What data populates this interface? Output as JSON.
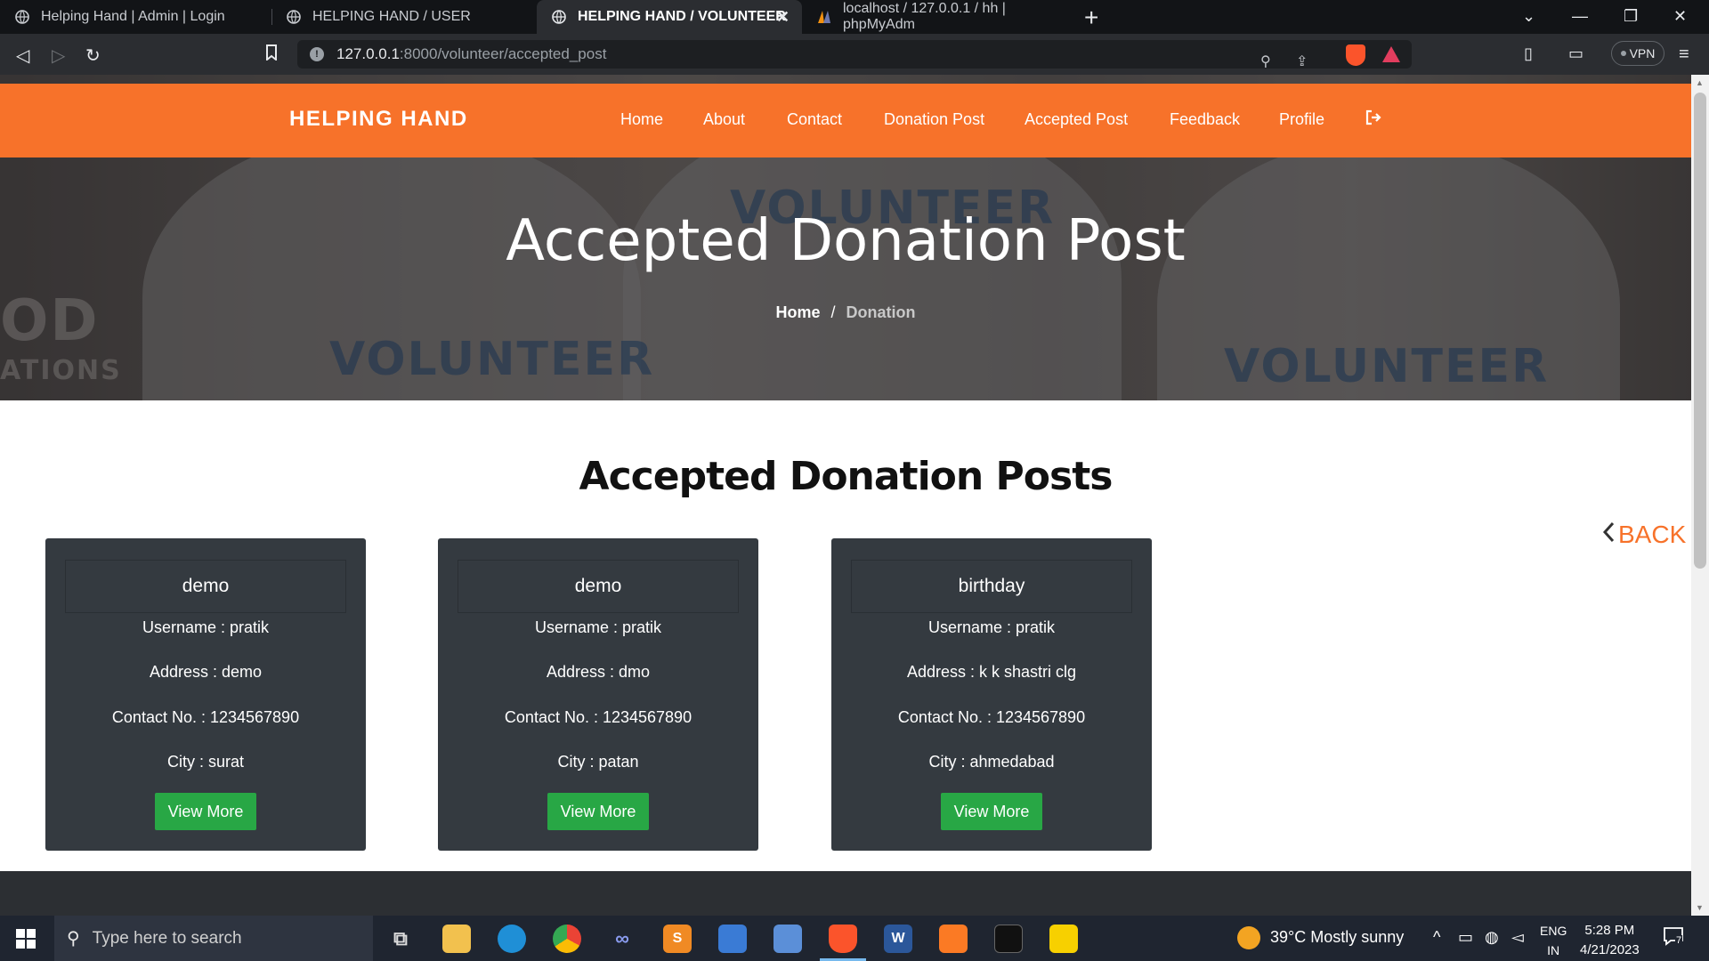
{
  "browser": {
    "tabs": [
      {
        "title": "Helping Hand | Admin | Login"
      },
      {
        "title": "HELPING HAND / USER"
      },
      {
        "title": "HELPING HAND / VOLUNTEER"
      },
      {
        "title": "localhost / 127.0.0.1 / hh | phpMyAdm"
      }
    ],
    "url_host": "127.0.0.1",
    "url_path": ":8000/volunteer/accepted_post",
    "vpn_label": "VPN",
    "shield_count": "1"
  },
  "site": {
    "brand": "HELPING HAND",
    "nav": [
      "Home",
      "About",
      "Contact",
      "Donation Post",
      "Accepted Post",
      "Feedback",
      "Profile"
    ]
  },
  "hero": {
    "title": "Accepted Donation Post",
    "breadcrumb_home": "Home",
    "breadcrumb_sep": "/",
    "breadcrumb_current": "Donation",
    "bg_words": [
      "VOLUNTEER",
      "VOLUNTEER",
      "VOLUNTEER",
      "OD",
      "ATIONS"
    ]
  },
  "section_title": "Accepted Donation Posts",
  "back_label": "BACK",
  "cards": [
    {
      "title": "demo",
      "username": "Username : pratik",
      "address": "Address : demo",
      "contact": "Contact No. : 1234567890",
      "city": "City : surat",
      "button": "View More"
    },
    {
      "title": "demo",
      "username": "Username : pratik",
      "address": "Address : dmo",
      "contact": "Contact No. : 1234567890",
      "city": "City : patan",
      "button": "View More"
    },
    {
      "title": "birthday",
      "username": "Username : pratik",
      "address": "Address : k k shastri clg",
      "contact": "Contact No. : 1234567890",
      "city": "City : ahmedabad",
      "button": "View More"
    }
  ],
  "taskbar": {
    "search_placeholder": "Type here to search",
    "weather": "39°C  Mostly sunny",
    "lang_top": "ENG",
    "lang_bottom": "IN",
    "time": "5:28 PM",
    "date": "4/21/2023",
    "notif_count": "7"
  },
  "colors": {
    "accent": "#f7722a",
    "card_bg": "#343a40",
    "button": "#28a745"
  }
}
